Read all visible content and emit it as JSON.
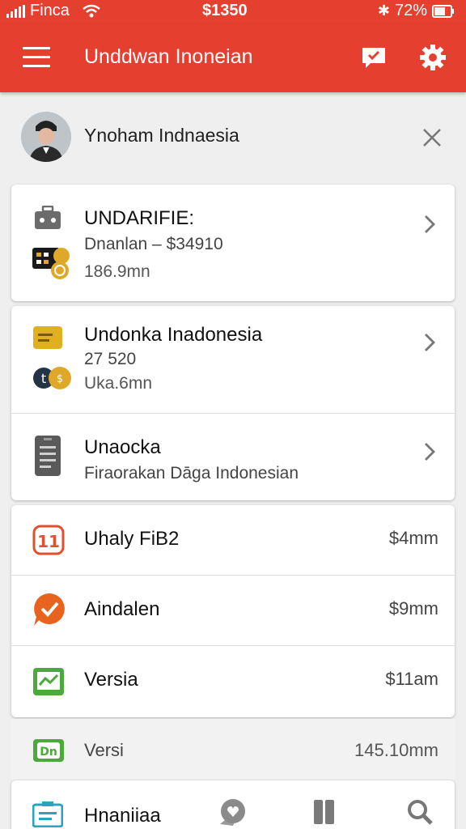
{
  "status_bar": {
    "carrier": "Finca",
    "time": "$1350",
    "battery": "72%"
  },
  "app_bar": {
    "title": "Unddwan Inoneian",
    "icons": [
      "menu-icon",
      "message-icon",
      "gear-icon"
    ]
  },
  "profile": {
    "name": "Ynoham Indnaesia"
  },
  "cards": [
    {
      "title": "UNDARIFIE:",
      "line2": "Dnanlan – $34910",
      "line3": "186.9mn"
    },
    {
      "title": "Undonka Inadonesia",
      "line2": "27 520",
      "line3": "Uka.6mn"
    },
    {
      "title": "Unaocka",
      "line2": "Fіraorakan Dāga Indonesian"
    }
  ],
  "list": [
    {
      "label": "Uhaly FiB2",
      "amount": "$4mm"
    },
    {
      "label": "Aindalen",
      "amount": "$9mm"
    },
    {
      "label": "Versia",
      "amount": "$11am"
    },
    {
      "label": "Versi",
      "amount": "145.10mm"
    }
  ],
  "bottom": {
    "label": "Hnaniiaa"
  },
  "colors": {
    "accent": "#e53f30",
    "background": "#efefef",
    "card": "#ffffff"
  }
}
